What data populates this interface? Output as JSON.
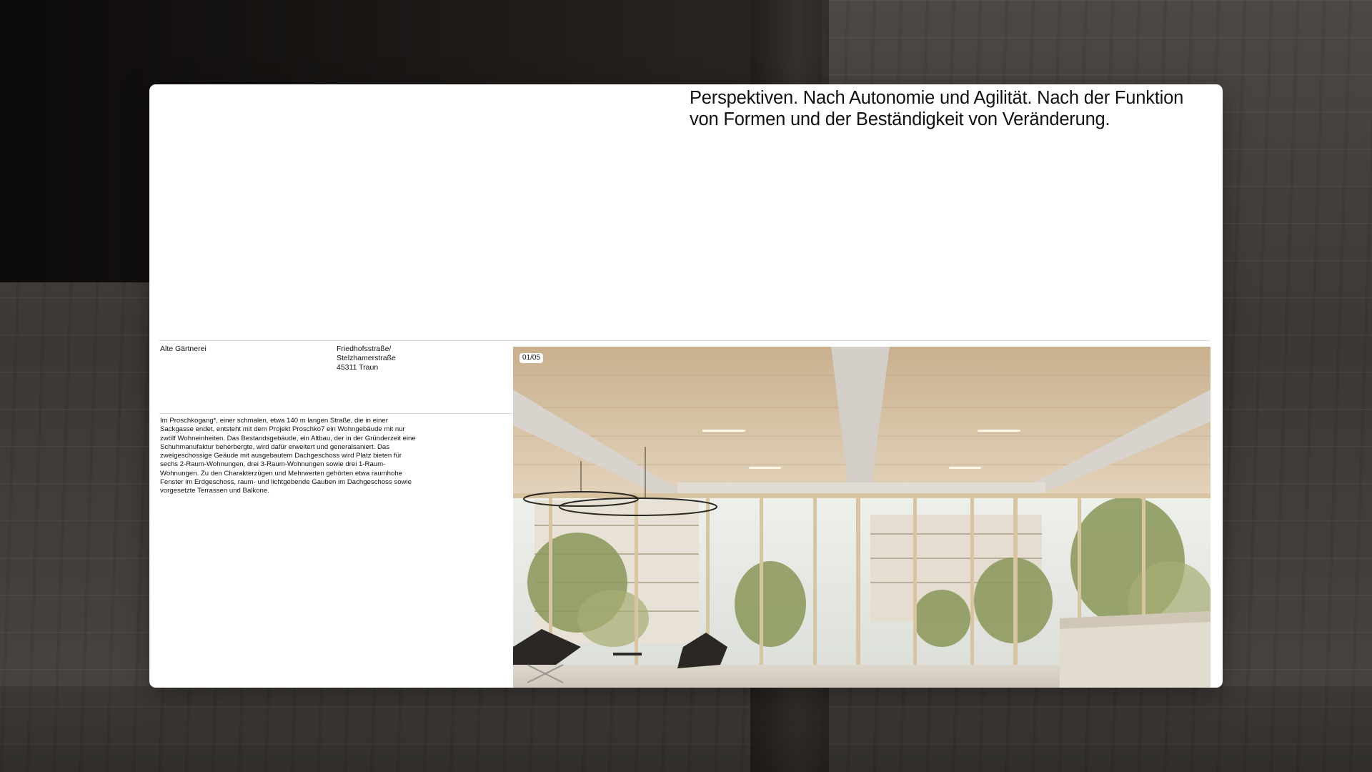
{
  "headline": "Perspektiven. Nach Autonomie und Agilität. Nach der Funktion von Formen und der Beständigkeit von Veränderung.",
  "project": {
    "name": "Alte Gärtnerei",
    "address_lines": [
      "Friedhofsstraße/",
      "Stelzhamerstraße",
      "45311 Traun"
    ],
    "description": "Im Proschkogang*, einer schmalen, etwa 140 m langen Straße, die in einer Sackgasse endet, entsteht mit dem Projekt Proschko7 ein Wohngebäude mit nur zwölf Wohneinheiten. Das Bestandsgebäude, ein Altbau, der in der Gründerzeit eine Schuhmanufaktur beherbergte, wird dafür erweitert und generalsaniert. Das zweigeschossige Geäude mit ausgebautem Dachgeschoss wird Platz bieten für sechs 2-Raum-Wohnungen, drei 3-Raum-Wohnungen sowie drei 1-Raum-Wohnungen. Zu den Charakterzügen und Mehrwerten gehörten etwa raumhohe Fenster im Erdgeschoss, raum- und lichtgebende Gauben im Dachgeschoss sowie vorgesetzte Terrassen und Balkone."
  },
  "gallery": {
    "counter": "01/05",
    "image_label": "Interior rendering of timber atrium building"
  }
}
